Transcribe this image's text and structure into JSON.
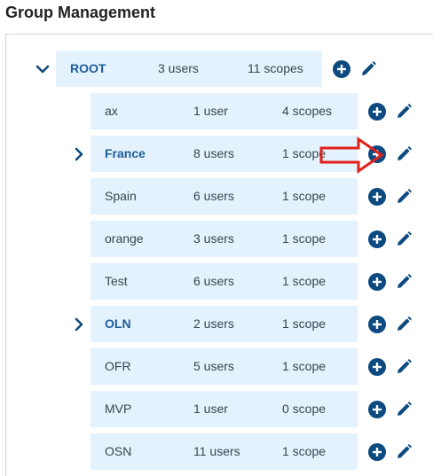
{
  "page": {
    "title": "Group Management"
  },
  "colors": {
    "row_bg": "#e3f2fc",
    "icon": "#0d4a80",
    "link": "#1e5d9b",
    "annotation": "#e0201b"
  },
  "root": {
    "name": "ROOT",
    "users": "3 users",
    "scopes": "11 scopes",
    "expanded": true
  },
  "children": [
    {
      "name": "ax",
      "users": "1 user",
      "scopes": "4 scopes",
      "expandable": false
    },
    {
      "name": "France",
      "users": "8 users",
      "scopes": "1 scope",
      "expandable": true
    },
    {
      "name": "Spain",
      "users": "6 users",
      "scopes": "1 scope",
      "expandable": false
    },
    {
      "name": "orange",
      "users": "3 users",
      "scopes": "1 scope",
      "expandable": false
    },
    {
      "name": "Test",
      "users": "6 users",
      "scopes": "1 scope",
      "expandable": false
    },
    {
      "name": "OLN",
      "users": "2 users",
      "scopes": "1 scope",
      "expandable": true
    },
    {
      "name": "OFR",
      "users": "5 users",
      "scopes": "1 scope",
      "expandable": false
    },
    {
      "name": "MVP",
      "users": "1 user",
      "scopes": "0 scope",
      "expandable": false
    },
    {
      "name": "OSN",
      "users": "11 users",
      "scopes": "1 scope",
      "expandable": false
    }
  ],
  "icons": {
    "expand": "chevron-right-icon",
    "collapse": "chevron-down-icon",
    "add": "plus-circle-icon",
    "edit": "pencil-icon",
    "annotation": "red-arrow-icon"
  }
}
